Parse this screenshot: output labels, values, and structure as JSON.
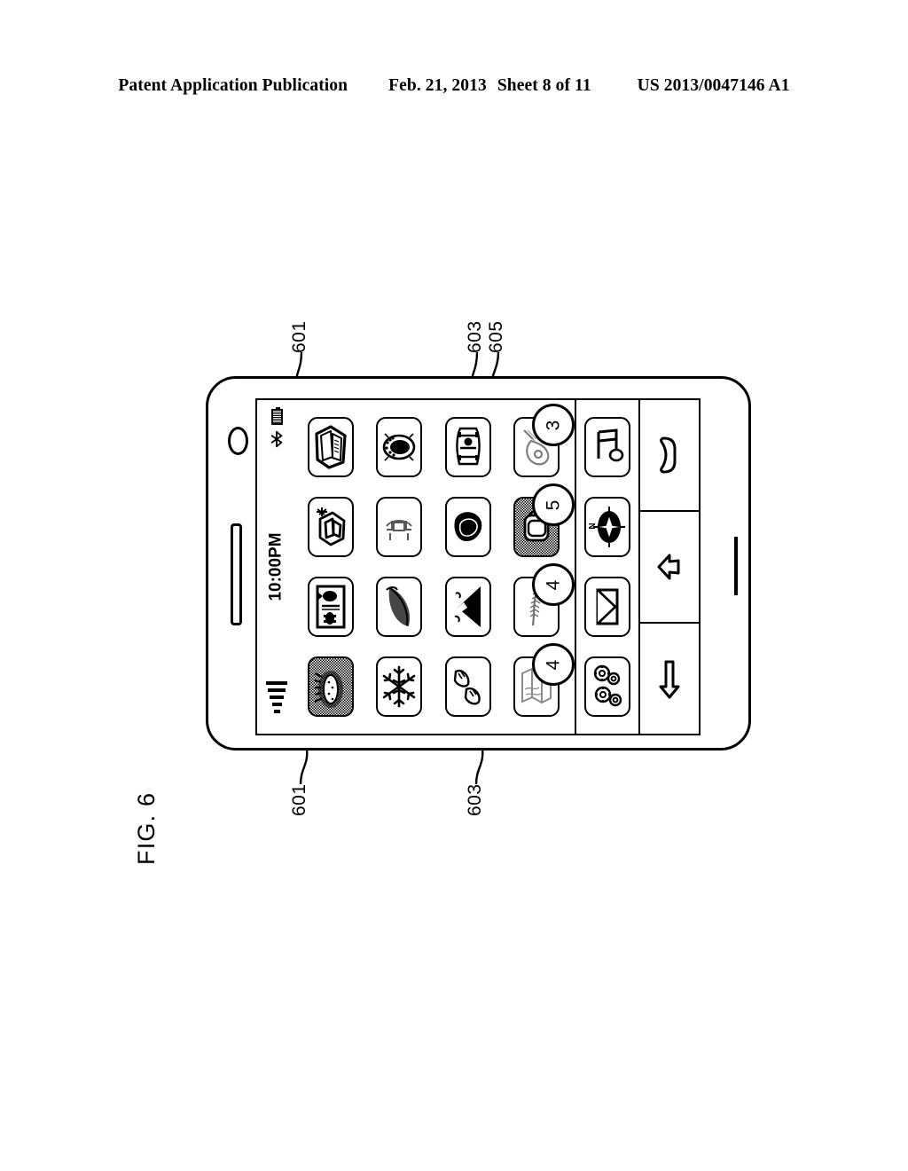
{
  "header": {
    "publication": "Patent Application Publication",
    "date": "Feb. 21, 2013",
    "sheet": "Sheet 8 of 11",
    "patent_number": "US 2013/0047146 A1"
  },
  "figure": {
    "caption": "FIG. 6",
    "reference_numerals": {
      "r601_top": "601",
      "r603_top": "603",
      "r605_top": "605",
      "r601_bottom": "601",
      "r603_bottom": "603"
    }
  },
  "device": {
    "status_bar": {
      "clock": "10:00PM",
      "battery_icon": "battery-icon",
      "bluetooth_icon": "bluetooth-icon",
      "signal_icon": "signal-strength-icon",
      "signal_bars": 5
    },
    "app_grid": {
      "rows": 4,
      "columns": 4,
      "apps": [
        {
          "name": "documents-app",
          "icon": "documents-icon",
          "badge": null,
          "shaded": false,
          "faded": false
        },
        {
          "name": "stadium-app",
          "icon": "stadium-icon",
          "badge": null,
          "shaded": false,
          "faded": false
        },
        {
          "name": "car-app",
          "icon": "car-icon",
          "badge": null,
          "shaded": false,
          "faded": false
        },
        {
          "name": "guitar-app",
          "icon": "guitar-icon",
          "badge": "3",
          "shaded": false,
          "faded": true
        },
        {
          "name": "photos-app",
          "icon": "photos-icon",
          "badge": null,
          "shaded": false,
          "faded": false
        },
        {
          "name": "bridge-app",
          "icon": "bridge-icon",
          "badge": null,
          "shaded": false,
          "faded": true
        },
        {
          "name": "helmet-app",
          "icon": "helmet-icon",
          "badge": null,
          "shaded": false,
          "faded": false
        },
        {
          "name": "bag-app",
          "icon": "bag-icon",
          "badge": "5",
          "shaded": true,
          "faded": false
        },
        {
          "name": "cards-app",
          "icon": "cards-icon",
          "badge": null,
          "shaded": false,
          "faded": false
        },
        {
          "name": "leaf-app",
          "icon": "leaf-icon",
          "badge": null,
          "shaded": false,
          "faded": false
        },
        {
          "name": "mountain-app",
          "icon": "mountain-icon",
          "badge": null,
          "shaded": false,
          "faded": false
        },
        {
          "name": "feather-app",
          "icon": "feather-icon",
          "badge": "4",
          "shaded": false,
          "faded": true
        },
        {
          "name": "sunrise-app",
          "icon": "sunrise-icon",
          "badge": null,
          "shaded": true,
          "faded": false
        },
        {
          "name": "snowflake-app",
          "icon": "snowflake-icon",
          "badge": null,
          "shaded": false,
          "faded": false
        },
        {
          "name": "shoes-app",
          "icon": "shoes-icon",
          "badge": null,
          "shaded": false,
          "faded": false
        },
        {
          "name": "map-app",
          "icon": "map-icon",
          "badge": "4",
          "shaded": false,
          "faded": true
        }
      ]
    },
    "dock": {
      "items": [
        {
          "name": "music-app",
          "icon": "music-note-icon"
        },
        {
          "name": "compass-app",
          "icon": "compass-icon",
          "label": "N"
        },
        {
          "name": "mail-app",
          "icon": "envelope-icon"
        },
        {
          "name": "settings-app",
          "icon": "gears-icon"
        }
      ]
    },
    "hardware_buttons": [
      {
        "name": "call-button",
        "icon": "phone-handset-icon"
      },
      {
        "name": "back-button",
        "icon": "back-arrow-icon"
      },
      {
        "name": "menu-button",
        "icon": "down-arrow-icon"
      }
    ]
  }
}
